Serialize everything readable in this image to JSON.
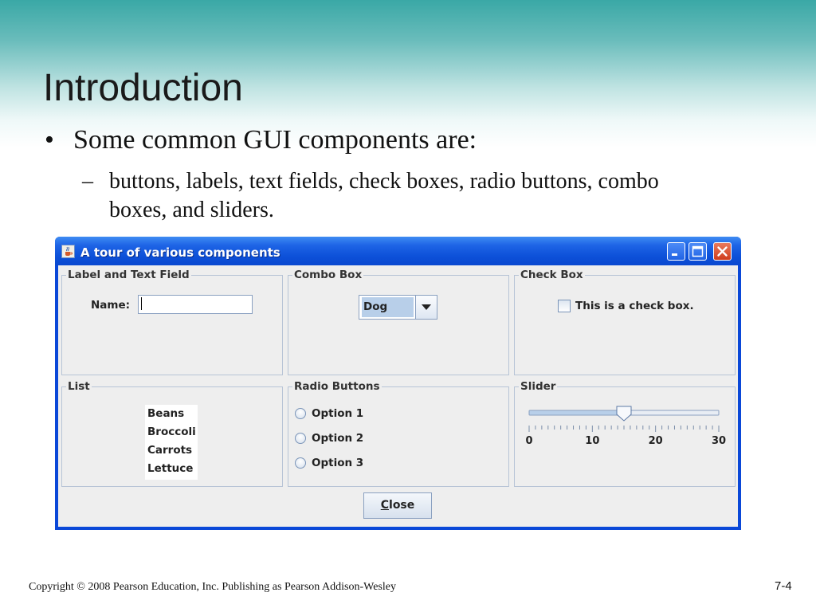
{
  "slide": {
    "title": "Introduction",
    "bullet_marker": "•",
    "bullet": "Some common GUI components are:",
    "sub_marker": "–",
    "sub_bullet": "buttons, labels, text fields, check boxes, radio buttons, combo boxes, and sliders.",
    "footer": "Copyright © 2008 Pearson Education, Inc. Publishing as Pearson Addison-Wesley",
    "page_number": "7-4"
  },
  "window": {
    "title": "A tour of various components",
    "icon": "java-cup-icon",
    "title_bar_color": "#0c50d8",
    "groups": {
      "label_text": {
        "title": "Label and Text Field",
        "name_label": "Name:",
        "name_value": ""
      },
      "combo": {
        "title": "Combo Box",
        "selected": "Dog"
      },
      "check": {
        "title": "Check Box",
        "label": "This is a check box.",
        "checked": false
      },
      "list": {
        "title": "List",
        "items": [
          "Beans",
          "Broccoli",
          "Carrots",
          "Lettuce"
        ]
      },
      "radio": {
        "title": "Radio Buttons",
        "options": [
          "Option 1",
          "Option 2",
          "Option 3"
        ]
      },
      "slider": {
        "title": "Slider",
        "min": 0,
        "max": 30,
        "value": 15,
        "labels": [
          "0",
          "10",
          "20",
          "30"
        ]
      }
    },
    "close_button": {
      "mnemonic": "C",
      "rest": "lose"
    }
  }
}
